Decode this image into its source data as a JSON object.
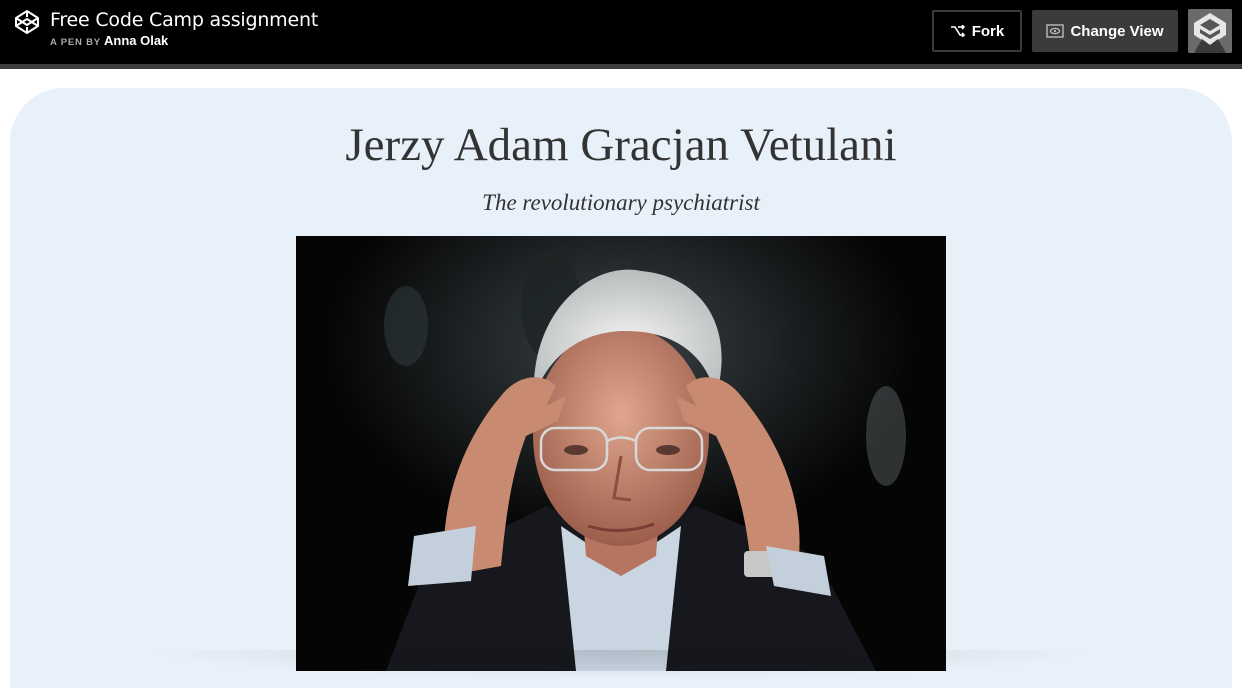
{
  "header": {
    "pen_title": "Free Code Camp assignment",
    "byline_prefix": "A PEN BY",
    "author": "Anna Olak",
    "fork_label": "Fork",
    "change_view_label": "Change View",
    "logo_icon": "codepen-logo-icon",
    "fork_icon": "fork-icon",
    "change_view_icon": "eye-icon",
    "avatar_icon": "user-avatar",
    "colors": {
      "bar": "#000000",
      "fork_border": "#3a3a3a",
      "change_view_bg": "#3b3b3d"
    }
  },
  "page": {
    "title": "Jerzy Adam Gracjan Vetulani",
    "subtitle": "The revolutionary psychiatrist",
    "background": "#e8f0fa",
    "image_icon": "portrait-photo"
  }
}
